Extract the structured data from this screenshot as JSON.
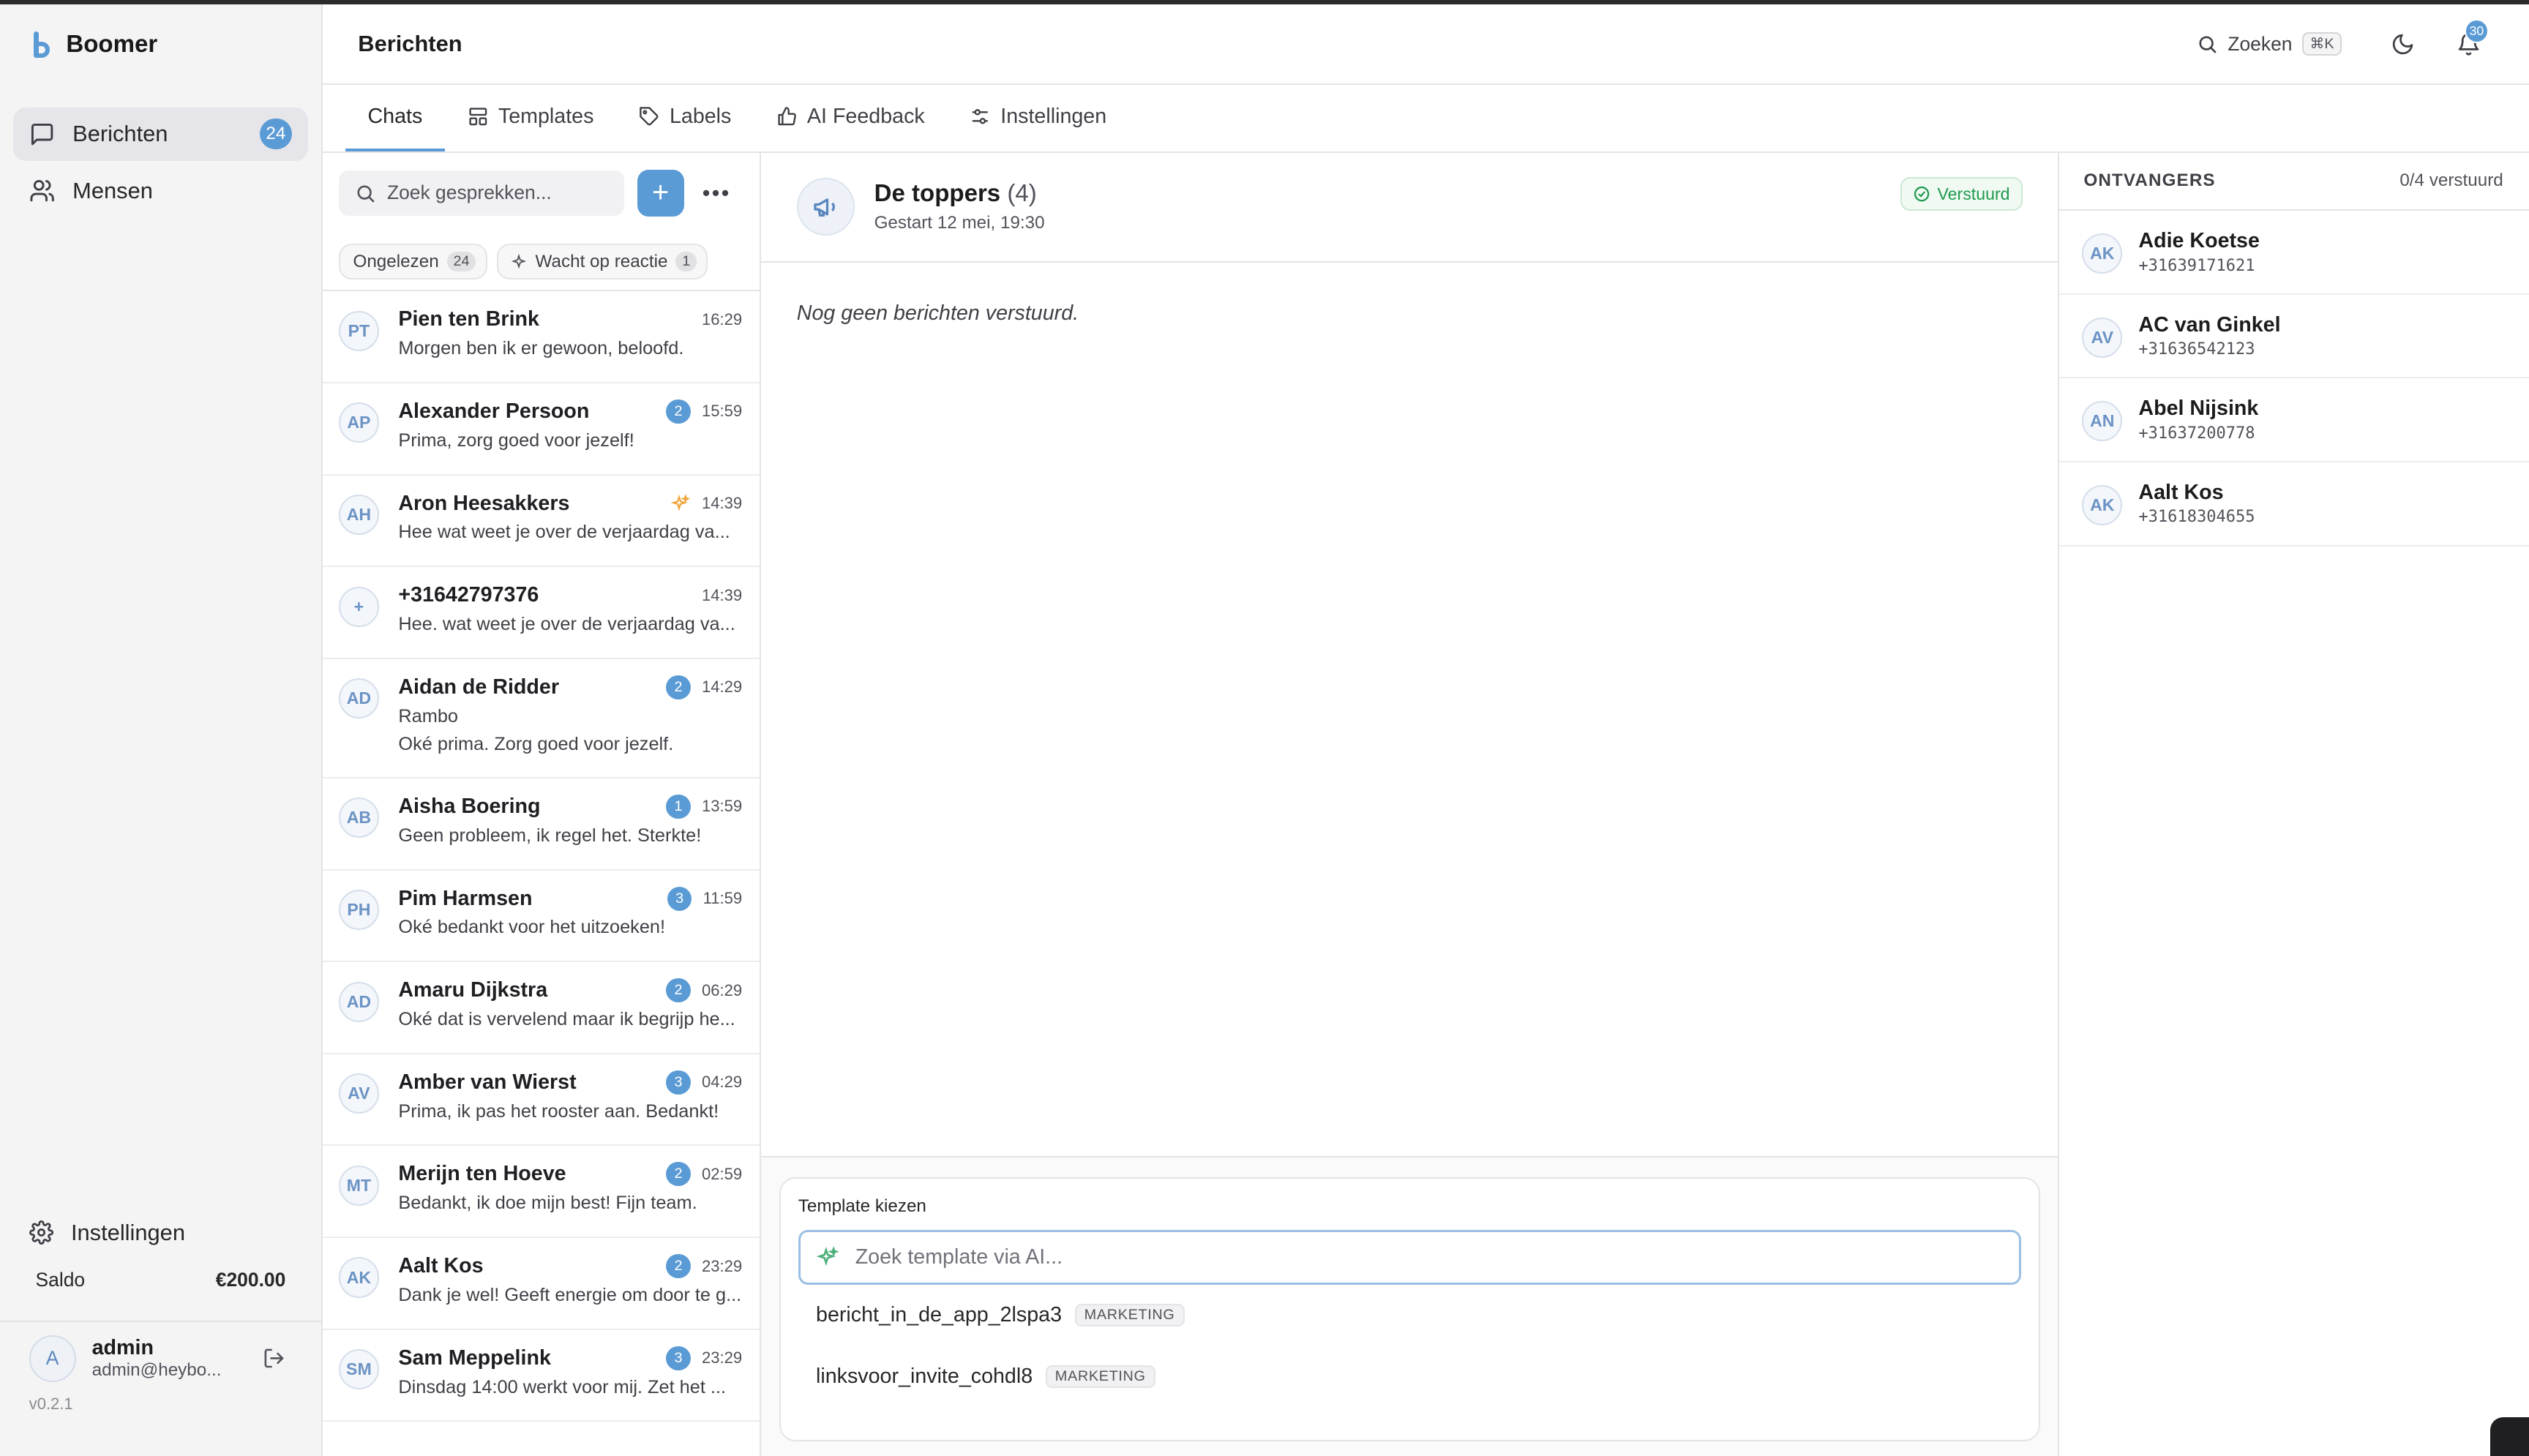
{
  "app": {
    "name": "Boomer",
    "version": "v0.2.1"
  },
  "sidebar": {
    "items": [
      {
        "label": "Berichten",
        "badge": "24",
        "icon": "message-square-icon"
      },
      {
        "label": "Mensen",
        "icon": "users-icon"
      }
    ],
    "settings_label": "Instellingen",
    "saldo_label": "Saldo",
    "saldo_value": "€200.00",
    "user": {
      "initial": "A",
      "name": "admin",
      "email": "admin@heybo..."
    }
  },
  "header": {
    "title": "Berichten",
    "search_label": "Zoeken",
    "shortcut": "⌘K",
    "notifications": "30"
  },
  "tabs": [
    {
      "label": "Chats",
      "icon": "chat-icon"
    },
    {
      "label": "Templates",
      "icon": "layout-icon"
    },
    {
      "label": "Labels",
      "icon": "tag-icon"
    },
    {
      "label": "AI Feedback",
      "icon": "thumbs-up-icon"
    },
    {
      "label": "Instellingen",
      "icon": "sliders-icon"
    }
  ],
  "chatlist": {
    "search_placeholder": "Zoek gesprekken...",
    "filters": [
      {
        "label": "Ongelezen",
        "count": "24"
      },
      {
        "label": "Wacht op reactie",
        "count": "1"
      }
    ],
    "conversations": [
      {
        "initials": "PT",
        "name": "Pien ten Brink",
        "time": "16:29",
        "unread": "",
        "message": "Morgen ben ik er gewoon, beloofd."
      },
      {
        "initials": "AP",
        "name": "Alexander Persoon",
        "time": "15:59",
        "unread": "2",
        "message": "Prima, zorg goed voor jezelf!"
      },
      {
        "initials": "AH",
        "name": "Aron Heesakkers",
        "time": "14:39",
        "unread": "",
        "sparkle": true,
        "message": "Hee wat weet je over de verjaardag va..."
      },
      {
        "initials": "+",
        "name": "+31642797376",
        "time": "14:39",
        "unread": "",
        "message": "Hee. wat weet je over de verjaardag va..."
      },
      {
        "initials": "AD",
        "name": "Aidan de Ridder",
        "time": "14:29",
        "unread": "2",
        "message": "Rambo",
        "message2": "Oké prima. Zorg goed voor jezelf."
      },
      {
        "initials": "AB",
        "name": "Aisha Boering",
        "time": "13:59",
        "unread": "1",
        "message": "Geen probleem, ik regel het. Sterkte!"
      },
      {
        "initials": "PH",
        "name": "Pim Harmsen",
        "time": "11:59",
        "unread": "3",
        "message": "Oké bedankt voor het uitzoeken!"
      },
      {
        "initials": "AD",
        "name": "Amaru Dijkstra",
        "time": "06:29",
        "unread": "2",
        "message": "Oké dat is vervelend maar ik begrijp he..."
      },
      {
        "initials": "AV",
        "name": "Amber van Wierst",
        "time": "04:29",
        "unread": "3",
        "message": "Prima, ik pas het rooster aan. Bedankt!"
      },
      {
        "initials": "MT",
        "name": "Merijn ten Hoeve",
        "time": "02:59",
        "unread": "2",
        "message": "Bedankt, ik doe mijn best! Fijn team."
      },
      {
        "initials": "AK",
        "name": "Aalt Kos",
        "time": "23:29",
        "unread": "2",
        "message": "Dank je wel! Geeft energie om door te g..."
      },
      {
        "initials": "SM",
        "name": "Sam Meppelink",
        "time": "23:29",
        "unread": "3",
        "message": "Dinsdag 14:00 werkt voor mij. Zet het ..."
      }
    ]
  },
  "chat": {
    "title": "De toppers",
    "count": "(4)",
    "subtitle": "Gestart 12 mei, 19:30",
    "status": "Verstuurd",
    "status_color": "#1f9a4e",
    "empty_text": "Nog geen berichten verstuurd."
  },
  "composer": {
    "label": "Template kiezen",
    "placeholder": "Zoek template via AI...",
    "templates": [
      {
        "name": "bericht_in_de_app_2lspa3",
        "tag": "MARKETING"
      },
      {
        "name": "linksvoor_invite_cohdl8",
        "tag": "MARKETING"
      }
    ]
  },
  "recipients": {
    "title": "ONTVANGERS",
    "count": "0/4 verstuurd",
    "items": [
      {
        "initials": "AK",
        "name": "Adie Koetse",
        "phone": "+31639171621"
      },
      {
        "initials": "AV",
        "name": "AC van Ginkel",
        "phone": "+31636542123"
      },
      {
        "initials": "AN",
        "name": "Abel Nijsink",
        "phone": "+31637200778"
      },
      {
        "initials": "AK",
        "name": "Aalt Kos",
        "phone": "+31618304655"
      }
    ]
  },
  "colors": {
    "accent": "#5b9bd5",
    "success": "#1f9a4e"
  }
}
